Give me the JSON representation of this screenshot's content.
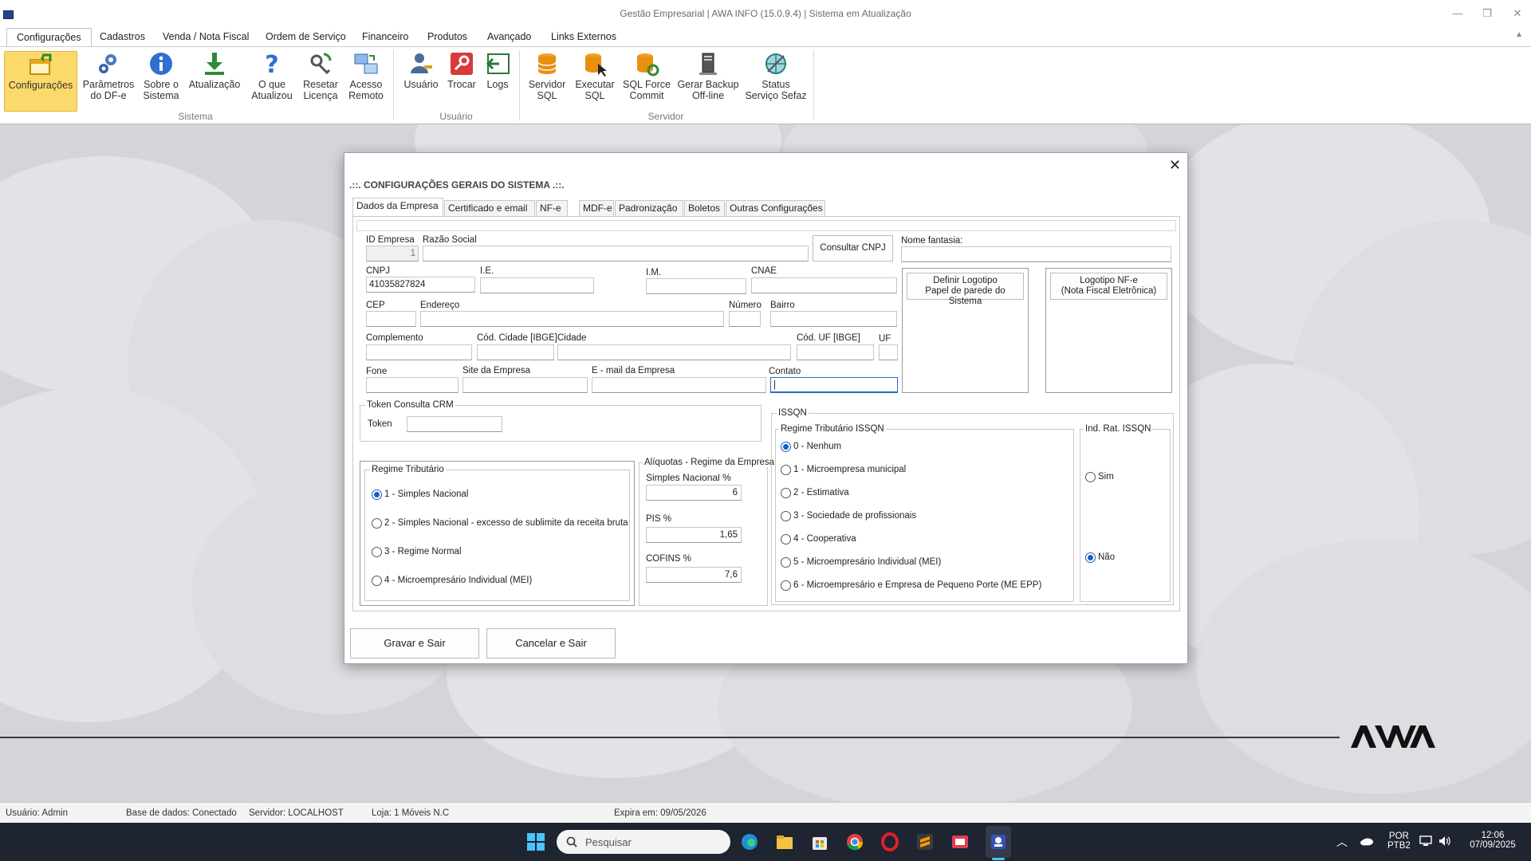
{
  "window": {
    "title": "Gestão Empresarial | AWA INFO (15.0.9.4) | Sistema em Atualização",
    "minimize": "—",
    "restore": "❐",
    "close": "✕"
  },
  "menu": {
    "tabs": [
      "Configurações",
      "Cadastros",
      "Venda / Nota Fiscal",
      "Ordem de Serviço",
      "Financeiro",
      "Produtos",
      "Avançado",
      "Links Externos"
    ],
    "collapse": "▲"
  },
  "ribbon": {
    "buttons": [
      {
        "l1": "Configurações",
        "l2": ""
      },
      {
        "l1": "Parâmetros",
        "l2": "do DF-e"
      },
      {
        "l1": "Sobre o",
        "l2": "Sistema"
      },
      {
        "l1": "Atualização",
        "l2": ""
      },
      {
        "l1": "O que",
        "l2": "Atualizou"
      },
      {
        "l1": "Resetar",
        "l2": "Licença"
      },
      {
        "l1": "Acesso",
        "l2": "Remoto"
      },
      {
        "l1": "Usuário",
        "l2": ""
      },
      {
        "l1": "Trocar",
        "l2": ""
      },
      {
        "l1": "Logs",
        "l2": ""
      },
      {
        "l1": "Servidor",
        "l2": "SQL"
      },
      {
        "l1": "Executar",
        "l2": "SQL"
      },
      {
        "l1": "SQL Force",
        "l2": "Commit"
      },
      {
        "l1": "Gerar Backup",
        "l2": "Off-line"
      },
      {
        "l1": "Status",
        "l2": "Serviço Sefaz"
      }
    ],
    "groups": [
      "Sistema",
      "Usuário",
      "Servidor"
    ]
  },
  "dialog": {
    "title": ".::. CONFIGURAÇÕES GERAIS DO SISTEMA .::.",
    "close": "✕",
    "tabs": [
      "Dados da Empresa",
      "Certificado e email",
      "NF-e",
      "MDF-e",
      "Padronização",
      "Boletos",
      "Outras Configurações"
    ],
    "labels": {
      "id": "ID Empresa",
      "razao": "Razão Social",
      "fantasia": "Nome fantasia:",
      "cnpj": "CNPJ",
      "ie": "I.E.",
      "im": "I.M.",
      "cnae": "CNAE",
      "cep": "CEP",
      "endereco": "Endereço",
      "numero": "Número",
      "bairro": "Bairro",
      "complemento": "Complemento",
      "cod_cidade": "Cód. Cidade [IBGE]",
      "cidade": "Cidade",
      "cod_uf": "Cód. UF [IBGE]",
      "uf": "UF",
      "fone": "Fone",
      "site": "Site da Empresa",
      "email": "E - mail da Empresa",
      "contato": "Contato"
    },
    "values": {
      "id": "1",
      "cnpj": "41035827824",
      "contato": "|"
    },
    "buttons": {
      "consultar": "Consultar CNPJ",
      "logo1_l1": "Definir Logotipo",
      "logo1_l2": "Papel de parede do Sistema",
      "logo2_l1": "Logotipo NF-e",
      "logo2_l2": "(Nota Fiscal Eletrônica)",
      "gravar": "Gravar e Sair",
      "cancelar": "Cancelar e Sair"
    },
    "token": {
      "group": "Token Consulta CRM",
      "label": "Token"
    },
    "regime": {
      "group": "Regime Tributário",
      "options": [
        "1 - Simples Nacional",
        "2 - Simples Nacional - excesso de sublimite da receita bruta",
        "3 - Regime Normal",
        "4 - Microempresário Individual (MEI)"
      ],
      "selected": 0
    },
    "aliquotas": {
      "group": "Alíquotas - Regime da Empresa",
      "simples_label": "Simples Nacional %",
      "simples_value": "6",
      "pis_label": "PIS %",
      "pis_value": "1,65",
      "cofins_label": "COFINS %",
      "cofins_value": "7,6"
    },
    "issqn": {
      "group": "ISSQN",
      "regime_group": "Regime Tributário ISSQN",
      "options": [
        "0 - Nenhum",
        "1 - Microempresa municipal",
        "2 - Estimativa",
        "3 - Sociedade de profissionais",
        "4 - Cooperativa",
        "5 - Microempresário Individual (MEI)",
        "6 - Microempresário e Empresa de Pequeno Porte (ME EPP)"
      ],
      "selected": 0,
      "ind_group": "Ind. Rat. ISSQN",
      "ind_sim": "Sim",
      "ind_nao": "Não"
    }
  },
  "status": {
    "usuario": "Usuário: Admin",
    "base": "Base de dados: Conectado",
    "servidor": "Servidor: LOCALHOST",
    "loja": "Loja: 1 Móveis N.C",
    "expira": "Expira em: 09/05/2026"
  },
  "taskbar": {
    "search": "Pesquisar",
    "lang1": "POR",
    "lang2": "PTB2",
    "time": "12:06",
    "date": "07/09/2025"
  },
  "colors": {
    "accent": "#1a5fc0",
    "ribbon_selected": "#fcd96b",
    "taskbar": "#1e2430"
  }
}
